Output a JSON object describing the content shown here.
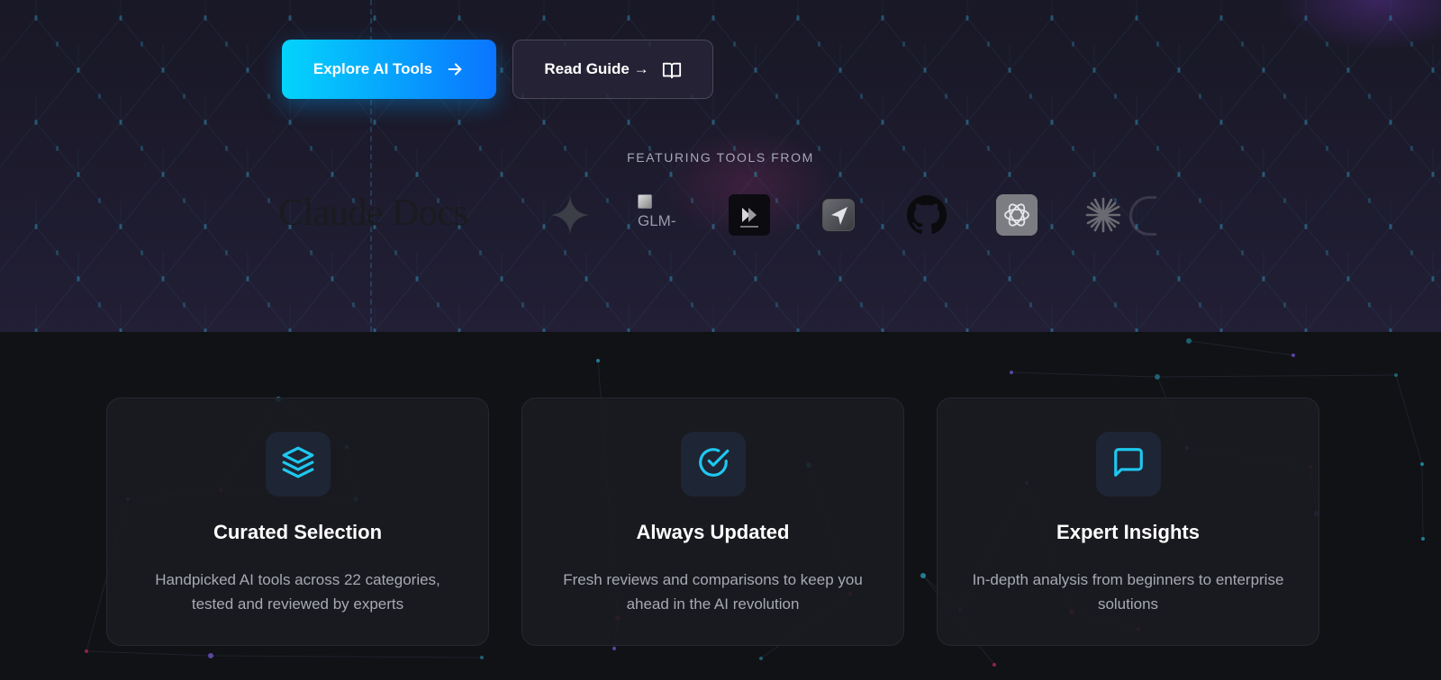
{
  "hero": {
    "explore_button": "Explore AI Tools",
    "guide_button": "Read Guide →",
    "featuring_label": "FEATURING TOOLS FROM",
    "logos": {
      "claude_docs": "Claude Docs",
      "glm_alt": "GLM-"
    }
  },
  "features": [
    {
      "icon": "layers-icon",
      "title": "Curated Selection",
      "description": "Handpicked AI tools across 22 categories, tested and reviewed by experts"
    },
    {
      "icon": "check-circle-icon",
      "title": "Always Updated",
      "description": "Fresh reviews and comparisons to keep you ahead in the AI revolution"
    },
    {
      "icon": "message-square-icon",
      "title": "Expert Insights",
      "description": "In-depth analysis from beginners to enterprise solutions"
    }
  ],
  "colors": {
    "accent_cyan": "#04d4fb",
    "accent_blue": "#0a74ff",
    "page_bg": "#111216",
    "card_bg": "#1a1b21",
    "icon_color": "#1ec8f0"
  }
}
